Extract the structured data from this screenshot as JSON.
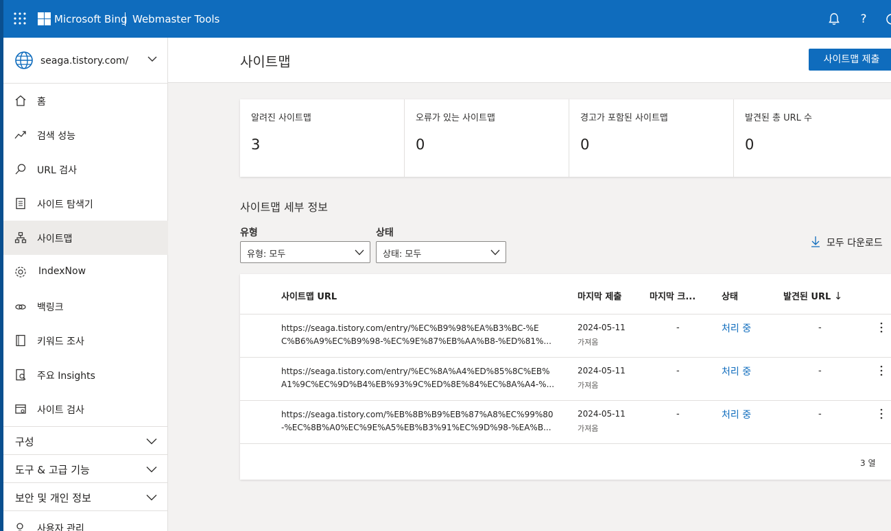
{
  "topbar": {
    "brand": "Microsoft Bing",
    "product": "Webmaster Tools",
    "icons": [
      "waffle-icon",
      "bell-icon",
      "help-icon",
      "settings-icon"
    ],
    "help_glyph": "?"
  },
  "sidebar": {
    "site": "seaga.tistory.com/",
    "items": [
      {
        "label": "홈",
        "icon": "home-icon"
      },
      {
        "label": "검색 성능",
        "icon": "trend-icon"
      },
      {
        "label": "URL 검사",
        "icon": "search-icon"
      },
      {
        "label": "사이트 탐색기",
        "icon": "site-explorer-icon"
      },
      {
        "label": "사이트맵",
        "icon": "sitemap-icon",
        "active": true
      },
      {
        "label": "IndexNow",
        "icon": "gear-icon"
      },
      {
        "label": "백링크",
        "icon": "link-icon"
      },
      {
        "label": "키워드 조사",
        "icon": "keyword-icon"
      },
      {
        "label": "주요 Insights",
        "icon": "insights-icon"
      },
      {
        "label": "사이트 검사",
        "icon": "site-scan-icon"
      }
    ],
    "groups": [
      "구성",
      "도구 & 고급 기능",
      "보안 및 개인 정보"
    ],
    "last_item": "사용자 관리"
  },
  "header": {
    "title": "사이트맵",
    "submit_label": "사이트맵 제출"
  },
  "cards": [
    {
      "label": "알려진 사이트맵",
      "value": "3"
    },
    {
      "label": "오류가 있는 사이트맵",
      "value": "0"
    },
    {
      "label": "경고가 포함된 사이트맵",
      "value": "0"
    },
    {
      "label": "발견된 총 URL 수",
      "value": "0"
    }
  ],
  "details": {
    "title": "사이트맵 세부 정보",
    "type_label": "유형",
    "type_value": "유형: 모두",
    "status_label": "상태",
    "status_value": "상태: 모두",
    "download_label": "모두 다운로드"
  },
  "table": {
    "headers": [
      "사이트맵 URL",
      "마지막 제출",
      "마지막 크...",
      "상태",
      "발견된 URL"
    ],
    "sort_glyph": "↓",
    "rows": [
      {
        "url_line1": "https://seaga.tistory.com/entry/%EC%B9%98%EA%B3%BC-%E",
        "url_line2": "C%B6%A9%EC%B9%98-%EC%9E%87%EB%AA%B8-%ED%81%...",
        "date": "2024-05-11",
        "fetched": "가져옴",
        "last_crawl": "-",
        "status": "처리 중",
        "found": "-"
      },
      {
        "url_line1": "https://seaga.tistory.com/entry/%EC%8A%A4%ED%85%8C%EB%",
        "url_line2": "A1%9C%EC%9D%B4%EB%93%9C%ED%8E%84%EC%8A%A4-%...",
        "date": "2024-05-11",
        "fetched": "가져옴",
        "last_crawl": "-",
        "status": "처리 중",
        "found": "-"
      },
      {
        "url_line1": "https://seaga.tistory.com/%EB%8B%B9%EB%87%A8%EC%99%80",
        "url_line2": "-%EC%8B%A0%EC%9E%A5%EB%B3%91%EC%9D%98-%EA%B...",
        "date": "2024-05-11",
        "fetched": "가져옴",
        "last_crawl": "-",
        "status": "처리 중",
        "found": "-"
      }
    ],
    "row_count": "3 열"
  },
  "colors": {
    "accent": "#0f6cbd",
    "active_bg": "#edebe9"
  }
}
